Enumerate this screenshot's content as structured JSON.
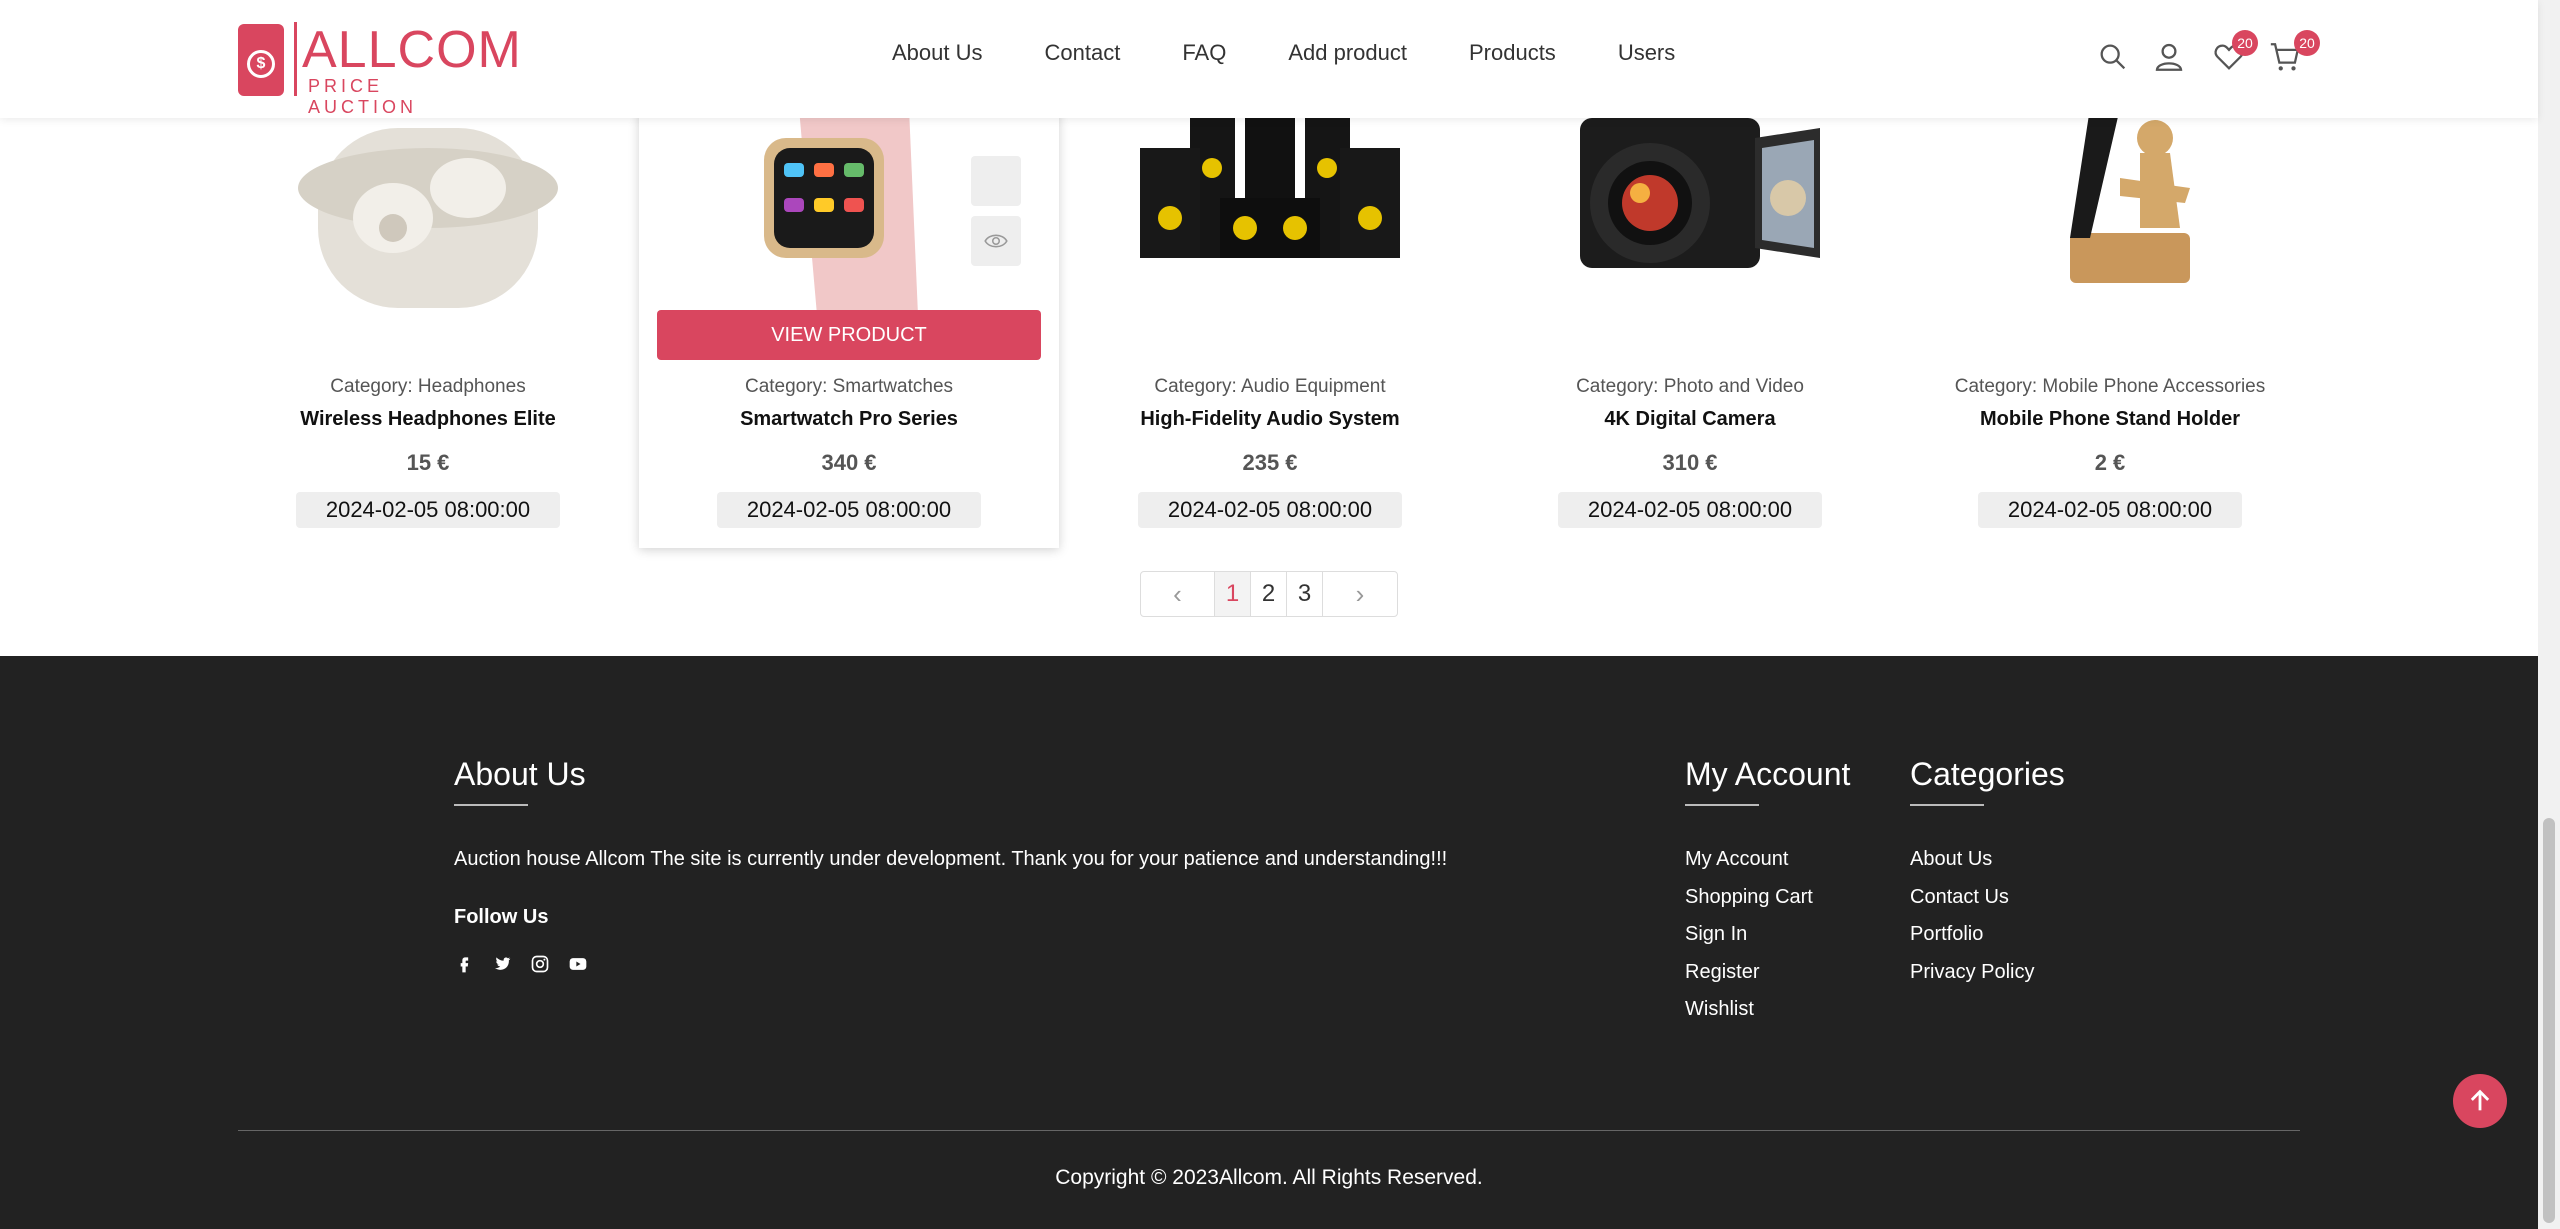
{
  "brand": {
    "name": "ALLCOM",
    "tagline": "PRICE AUCTION"
  },
  "nav": [
    "About Us",
    "Contact",
    "FAQ",
    "Add product",
    "Products",
    "Users"
  ],
  "header_icons": {
    "wishlist_count": "20",
    "cart_count": "20"
  },
  "view_product_label": "VIEW PRODUCT",
  "products": [
    {
      "category": "Category: Headphones",
      "name": "Wireless Headphones Elite",
      "price": "15 €",
      "date": "2024-02-05 08:00:00",
      "image": "earbuds-image"
    },
    {
      "category": "Category: Smartwatches",
      "name": "Smartwatch Pro Series",
      "price": "340 €",
      "date": "2024-02-05 08:00:00",
      "image": "smartwatch-image"
    },
    {
      "category": "Category: Audio Equipment",
      "name": "High-Fidelity Audio System",
      "price": "235 €",
      "date": "2024-02-05 08:00:00",
      "image": "speaker-system-image"
    },
    {
      "category": "Category: Photo and Video",
      "name": "4K Digital Camera",
      "price": "310 €",
      "date": "2024-02-05 08:00:00",
      "image": "camera-image"
    },
    {
      "category": "Category: Mobile Phone Accessories",
      "name": "Mobile Phone Stand Holder",
      "price": "2 €",
      "date": "2024-02-05 08:00:00",
      "image": "phone-stand-image"
    }
  ],
  "pagination": {
    "prev": "‹",
    "pages": [
      "1",
      "2",
      "3"
    ],
    "current": "1",
    "next": "›"
  },
  "footer": {
    "about_title": "About Us",
    "about_text": "Auction house Allcom The site is currently under development. Thank you for your patience and understanding!!!",
    "follow_title": "Follow Us",
    "social_icons": [
      "facebook-icon",
      "twitter-icon",
      "instagram-icon",
      "youtube-icon"
    ],
    "account_title": "My Account",
    "account_links": [
      "My Account",
      "Shopping Cart",
      "Sign In",
      "Register",
      "Wishlist"
    ],
    "categories_title": "Categories",
    "categories_links": [
      "About Us",
      "Contact Us",
      "Portfolio",
      "Privacy Policy"
    ],
    "copyright": "Copyright © 2023Allcom. All Rights Reserved."
  },
  "colors": {
    "accent": "#d9465f",
    "footer_bg": "#222222"
  }
}
